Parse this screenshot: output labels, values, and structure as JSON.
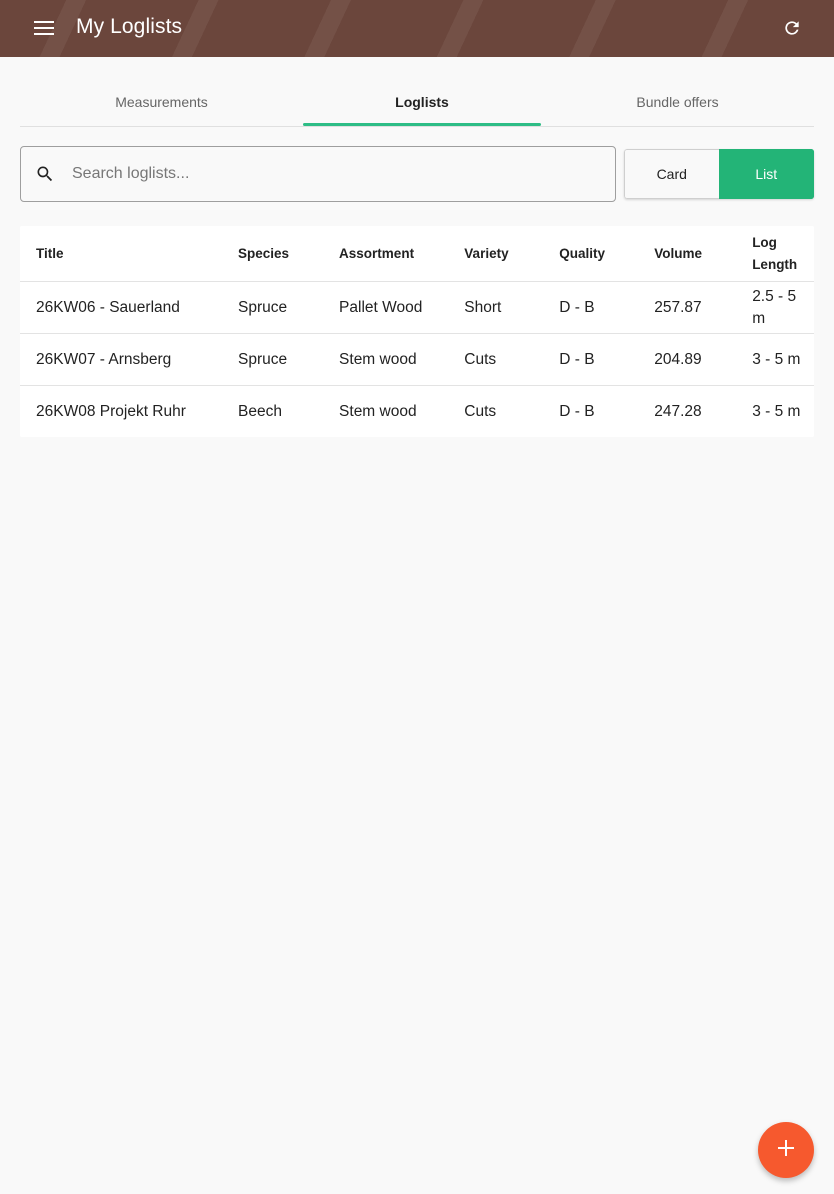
{
  "app_bar": {
    "title": "My Loglists",
    "color": "#6b463c",
    "menu_icon": "hamburger-menu-icon",
    "refresh_icon": "refresh-icon"
  },
  "tabs": [
    {
      "label": "Measurements",
      "active": false
    },
    {
      "label": "Loglists",
      "active": true
    },
    {
      "label": "Bundle offers",
      "active": false
    }
  ],
  "accent_color": "#2ebd86",
  "search": {
    "placeholder": "Search loglists...",
    "value": ""
  },
  "view_toggle": {
    "card_label": "Card",
    "list_label": "List",
    "selected": "List"
  },
  "table": {
    "headers": [
      "Title",
      "Species",
      "Assortment",
      "Variety",
      "Quality",
      "Volume",
      "Log Length"
    ],
    "rows": [
      [
        "26KW06 - Sauerland",
        "Spruce",
        "Pallet Wood",
        "Short",
        "D - B",
        "257.87",
        "2.5 - 5 m"
      ],
      [
        "26KW07 - Arnsberg",
        "Spruce",
        "Stem wood",
        "Cuts",
        "D - B",
        "204.89",
        "3 - 5 m"
      ],
      [
        "26KW08 Projekt Ruhr",
        "Beech",
        "Stem wood",
        "Cuts",
        "D - B",
        "247.28",
        "3 - 5 m"
      ]
    ]
  },
  "fab": {
    "icon": "plus-icon",
    "color": "#f6592e"
  }
}
